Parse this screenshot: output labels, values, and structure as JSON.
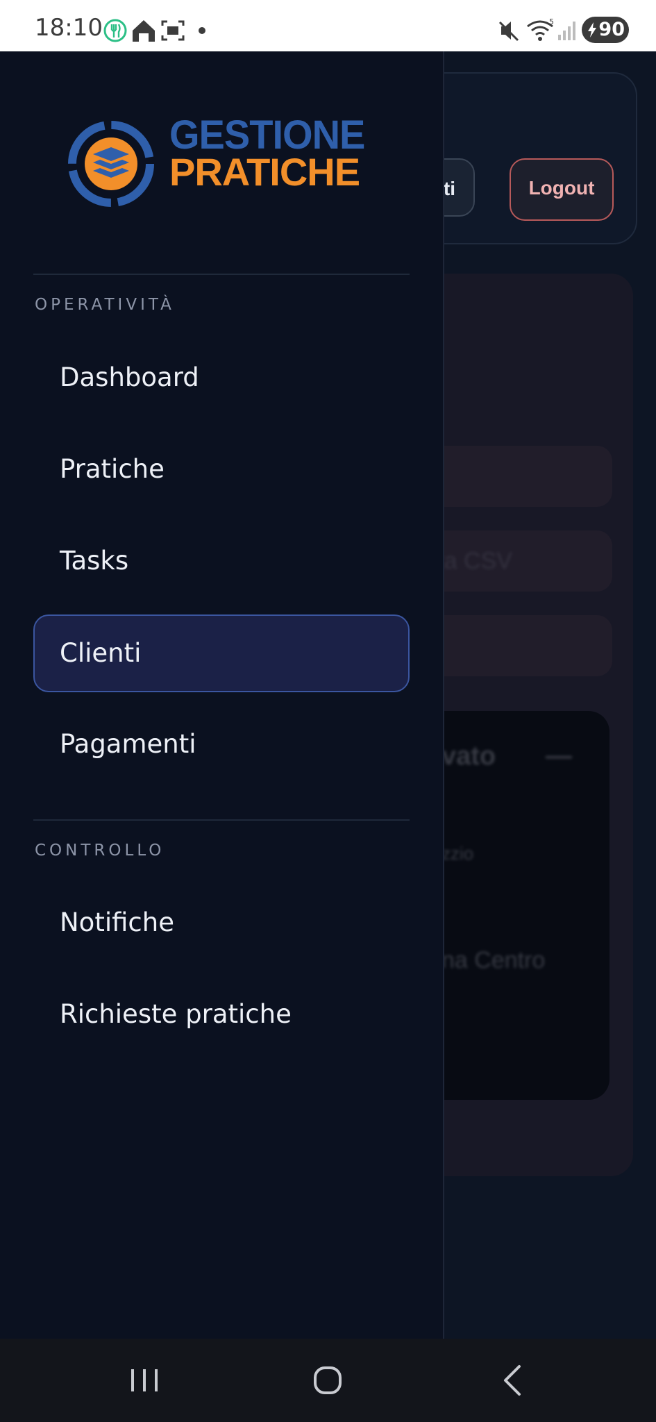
{
  "status_bar": {
    "time": "18:10",
    "battery": "90",
    "left_icons": [
      "fork-knife-icon",
      "home-icon",
      "screenshot-icon",
      "dot-icon"
    ],
    "right_icons": [
      "mute-icon",
      "wifi-icon",
      "signal-icon",
      "battery-icon"
    ]
  },
  "background": {
    "clienti_button_fragment": "ti",
    "logout_button": "Logout",
    "field_1": "a",
    "field_2": "orta CSV",
    "pill_1": "vato",
    "pill_2": "—",
    "text_1": "zzio",
    "text_2": "na Centro"
  },
  "drawer": {
    "logo": {
      "line1": "GESTIONE",
      "line2": "PRATICHE"
    },
    "sections": [
      {
        "label": "OPERATIVITÀ",
        "items": [
          "Dashboard",
          "Pratiche",
          "Tasks",
          "Clienti",
          "Pagamenti"
        ]
      },
      {
        "label": "CONTROLLO",
        "items": [
          "Notifiche",
          "Richieste pratiche"
        ]
      }
    ],
    "active_item": "Clienti"
  },
  "colors": {
    "drawer_bg": "#0b1120",
    "active_bg": "#1b2147",
    "active_border": "#3b56a0",
    "logo_blue": "#2f5fab",
    "logo_orange": "#f28f2a",
    "logout_border": "#b85a5a"
  }
}
